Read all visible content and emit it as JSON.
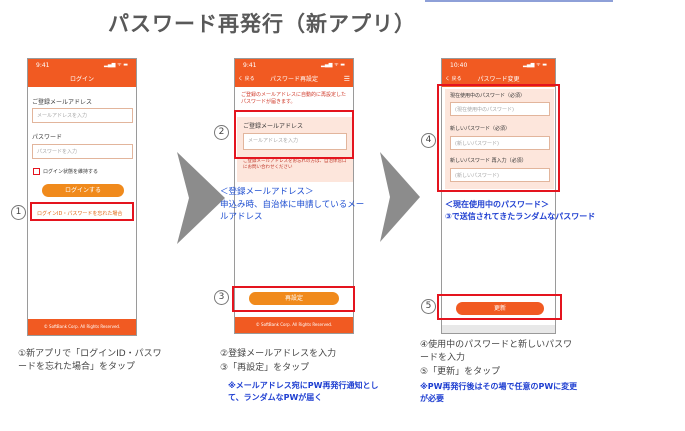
{
  "title": "パスワード再発行（新アプリ）",
  "phone1": {
    "time": "9:41",
    "indicators": "▂▄▆ ᯤ ▬",
    "nav_title": "ログイン",
    "email_label": "ご登録メールアドレス",
    "email_placeholder": "メールアドレスを入力",
    "password_label": "パスワード",
    "password_placeholder": "パスワードを入力",
    "keep_login": "ログイン状態を維持する",
    "login_button": "ログインする",
    "forgot_link": "ログインID・パスワードを忘れた場合",
    "footer": "© SoftBank Corp. All Rights Reserved."
  },
  "phone2": {
    "time": "9:41",
    "back": "く 戻る",
    "nav_title": "パスワード再設定",
    "menu": "☰",
    "info": "ご登録のメールアドレスに自動的に再設定したパスワードが届きます。",
    "email_label": "ご登録メールアドレス",
    "email_placeholder": "メールアドレスを入力",
    "note": "ご登録メールアドレスをお忘れの方は、自治体窓口にお問い合わせください",
    "reset_button": "再設定",
    "footer": "© SoftBank Corp. All Rights Reserved."
  },
  "phone3": {
    "time": "10:40",
    "back": "く 戻る",
    "nav_title": "パスワード変更",
    "current_label": "現在使用中のパスワード（必須）",
    "current_placeholder": "(現在使用中のパスワード)",
    "new_label": "新しいパスワード（必須）",
    "new_placeholder": "(新しいパスワード)",
    "confirm_label": "新しいパスワード 再入力（必須）",
    "confirm_placeholder": "(新しいパスワード)",
    "update_button": "更新"
  },
  "markers": {
    "m1": "1",
    "m2": "2",
    "m3": "3",
    "m4": "4",
    "m5": "5"
  },
  "annotations": {
    "email_heading": "＜登録メールアドレス＞",
    "email_desc": "申込み時、自治体に申請しているメールアドレス",
    "current_pw_heading": "＜現在使用中のパスワード＞",
    "current_pw_desc": "③で送信されてきたランダムなパスワード"
  },
  "steps": {
    "step1": "①新アプリで「ログインID・パスワードを忘れた場合」をタップ",
    "step2a": "②登録メールアドレスを入力",
    "step2b": "③「再設定」をタップ",
    "step2_note": "※メールアドレス宛にPW再発行通知として、ランダムなPWが届く",
    "step3a": "④使用中のパスワードと新しいパスワードを入力",
    "step3b": "⑤「更新」をタップ",
    "step3_note": "※PW再発行後はその場で任意のPWに変更が必要"
  },
  "colors": {
    "brand_orange": "#f15a22",
    "button_orange": "#f08a1c",
    "highlight_red": "#e4141e",
    "arrow_gray": "#8c8c8c",
    "annotation_blue": "#1f4fd1"
  }
}
